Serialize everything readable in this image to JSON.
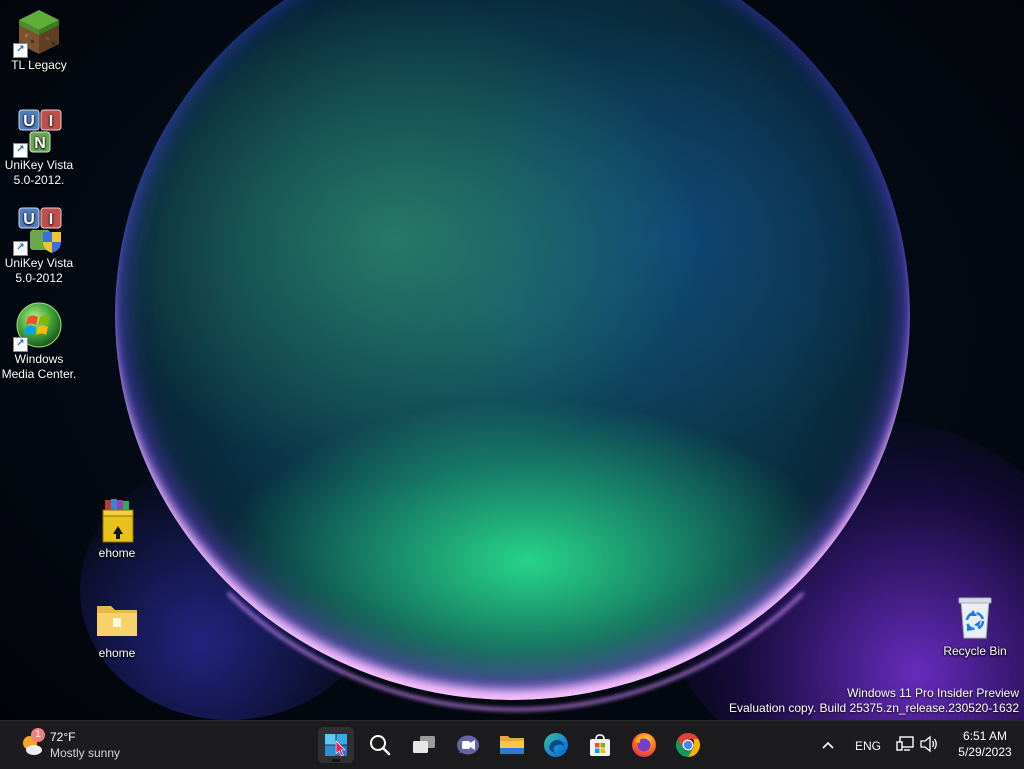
{
  "desktop": {
    "icons": [
      {
        "label": "TL Legacy",
        "icon": "minecraft-grass-block-icon",
        "shortcut": true
      },
      {
        "label": "UniKey Vista 5.0-2012.",
        "icon": "unikey-icon",
        "shortcut": true
      },
      {
        "label": "UniKey Vista 5.0-2012",
        "icon": "unikey-shield-icon",
        "shortcut": true
      },
      {
        "label": "Windows Media Center.",
        "icon": "windows-media-center-icon",
        "shortcut": true
      },
      {
        "label": "ehome",
        "icon": "winrar-archive-icon",
        "shortcut": false
      },
      {
        "label": "ehome",
        "icon": "folder-icon",
        "shortcut": false
      },
      {
        "label": "Recycle Bin",
        "icon": "recycle-bin-icon",
        "shortcut": false
      }
    ]
  },
  "watermark": {
    "line1": "Windows 11 Pro Insider Preview",
    "line2": "Evaluation copy. Build 25375.zn_release.230520-1632"
  },
  "taskbar": {
    "weather": {
      "temp": "72°F",
      "condition": "Mostly sunny",
      "badge": "1",
      "icon": "sun-cloud-icon"
    },
    "apps": [
      {
        "name": "start",
        "icon": "start-icon",
        "active": true
      },
      {
        "name": "search",
        "icon": "search-icon",
        "active": false
      },
      {
        "name": "task-view",
        "icon": "task-view-icon",
        "active": false
      },
      {
        "name": "chat",
        "icon": "teams-chat-icon",
        "active": false
      },
      {
        "name": "file-explorer",
        "icon": "folder-icon",
        "active": false
      },
      {
        "name": "edge",
        "icon": "edge-icon",
        "active": false
      },
      {
        "name": "store",
        "icon": "microsoft-store-icon",
        "active": false
      },
      {
        "name": "firefox",
        "icon": "firefox-icon",
        "active": false
      },
      {
        "name": "chrome",
        "icon": "chrome-icon",
        "active": false
      }
    ],
    "tray": {
      "language": "ENG",
      "time": "6:51 AM",
      "date": "5/29/2023"
    }
  },
  "colors": {
    "taskbar_bg": "#1c1c1e",
    "accent": "#00a4ef"
  }
}
